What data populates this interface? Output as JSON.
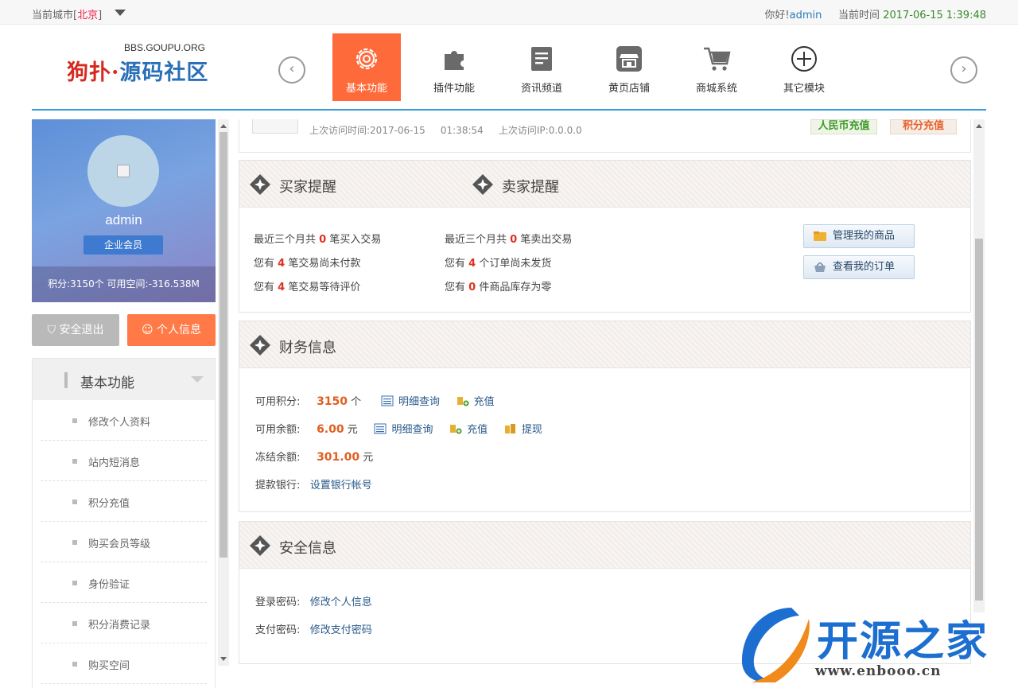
{
  "topbar": {
    "city_label": "当前城市[",
    "city_name": "北京",
    "city_close": "]",
    "greeting": "你好!",
    "username": "admin",
    "time_label": "当前时间",
    "time_value": "2017-06-15 1:39:48"
  },
  "logo": {
    "domain": "BBS.GOUPU.ORG",
    "part1": "狗扑·",
    "part2": "源码社区"
  },
  "nav": {
    "items": [
      {
        "label": "基本功能",
        "icon": "gear-icon",
        "active": true
      },
      {
        "label": "插件功能",
        "icon": "puzzle-icon"
      },
      {
        "label": "资讯频道",
        "icon": "document-icon"
      },
      {
        "label": "黄页店铺",
        "icon": "store-icon"
      },
      {
        "label": "商城系统",
        "icon": "cart-icon"
      },
      {
        "label": "其它模块",
        "icon": "plus-circle-icon"
      }
    ],
    "prev": "‹",
    "next": "›"
  },
  "profile": {
    "name": "admin",
    "level": "企业会员",
    "stats": "积分:3150个   可用空间:-316.538M",
    "logout_label": "安全退出",
    "info_label": "个人信息"
  },
  "menu": {
    "title": "基本功能",
    "items": [
      "修改个人资料",
      "站内短消息",
      "积分充值",
      "购买会员等级",
      "身份验证",
      "积分消费记录",
      "购买空间"
    ]
  },
  "top_strip": {
    "last_visit_label": "上次访问时间:",
    "last_visit_date": "2017-06-15",
    "last_visit_time": "01:38:54",
    "last_ip_label": "上次访问IP:",
    "last_ip": "0.0.0.0",
    "rmb_recharge": "人民币充值",
    "points_recharge": "积分充值"
  },
  "reminder": {
    "buyer_title": "买家提醒",
    "seller_title": "卖家提醒",
    "buyer": [
      {
        "pre": "最近三个月共 ",
        "num": "0",
        "post": " 笔买入交易"
      },
      {
        "pre": "您有 ",
        "num": "4",
        "post": " 笔交易尚未付款"
      },
      {
        "pre": "您有 ",
        "num": "4",
        "post": " 笔交易等待评价"
      }
    ],
    "seller": [
      {
        "pre": "最近三个月共 ",
        "num": "0",
        "post": " 笔卖出交易"
      },
      {
        "pre": "您有 ",
        "num": "4",
        "post": " 个订单尚未发货"
      },
      {
        "pre": "您有 ",
        "num": "0",
        "post": " 件商品库存为零"
      }
    ],
    "manage_goods": "管理我的商品",
    "view_orders": "查看我的订单"
  },
  "finance": {
    "title": "财务信息",
    "points_label": "可用积分:",
    "points_value": "3150",
    "points_unit": "个",
    "balance_label": "可用余额:",
    "balance_value": "6.00",
    "balance_unit": "元",
    "frozen_label": "冻结余额:",
    "frozen_value": "301.00",
    "frozen_unit": "元",
    "bank_label": "提款银行:",
    "bank_link": "设置银行帐号",
    "detail": "明细查询",
    "recharge": "充值",
    "withdraw": "提现"
  },
  "security": {
    "title": "安全信息",
    "login_label": "登录密码:",
    "login_link": "修改个人信息",
    "pay_label": "支付密码:",
    "pay_link": "修改支付密码"
  },
  "watermark": {
    "text": "开源之家",
    "url": "www.enbooo.cn"
  },
  "colors": {
    "accent": "#ff6a3a",
    "brand_blue": "#3a9fd6",
    "number_red": "#e03020"
  }
}
